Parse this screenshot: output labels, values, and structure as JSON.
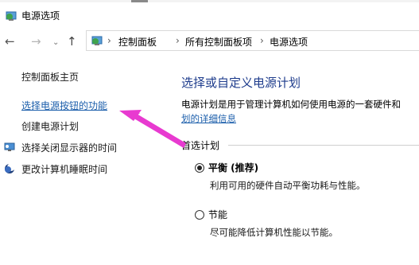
{
  "window": {
    "title": "电源选项"
  },
  "nav": {
    "back": "←",
    "forward": "→",
    "recent": "⌄",
    "up": "↑",
    "breadcrumbs": [
      "控制面板",
      "所有控制面板项",
      "电源选项"
    ],
    "separator": "›"
  },
  "sidebar": {
    "items": [
      {
        "label": "控制面板主页"
      },
      {
        "label": "选择电源按钮的功能"
      },
      {
        "label": "创建电源计划"
      },
      {
        "label": "选择关闭显示器的时间"
      },
      {
        "label": "更改计算机睡眠时间"
      }
    ]
  },
  "main": {
    "heading": "选择或自定义电源计划",
    "description": "电源计划是用于管理计算机如何使用电源的一套硬件和",
    "description_link": "划的详细信息",
    "section_label": "首选计划",
    "plans": [
      {
        "name": "平衡 (推荐)",
        "desc": "利用可用的硬件自动平衡功耗与性能。",
        "selected": true
      },
      {
        "name": "节能",
        "desc": "尽可能降低计算机性能以节能。",
        "selected": false
      }
    ]
  },
  "colors": {
    "link": "#1b5eab",
    "heading": "#1e3c8c",
    "annotation_arrow": "#e83ad0"
  }
}
